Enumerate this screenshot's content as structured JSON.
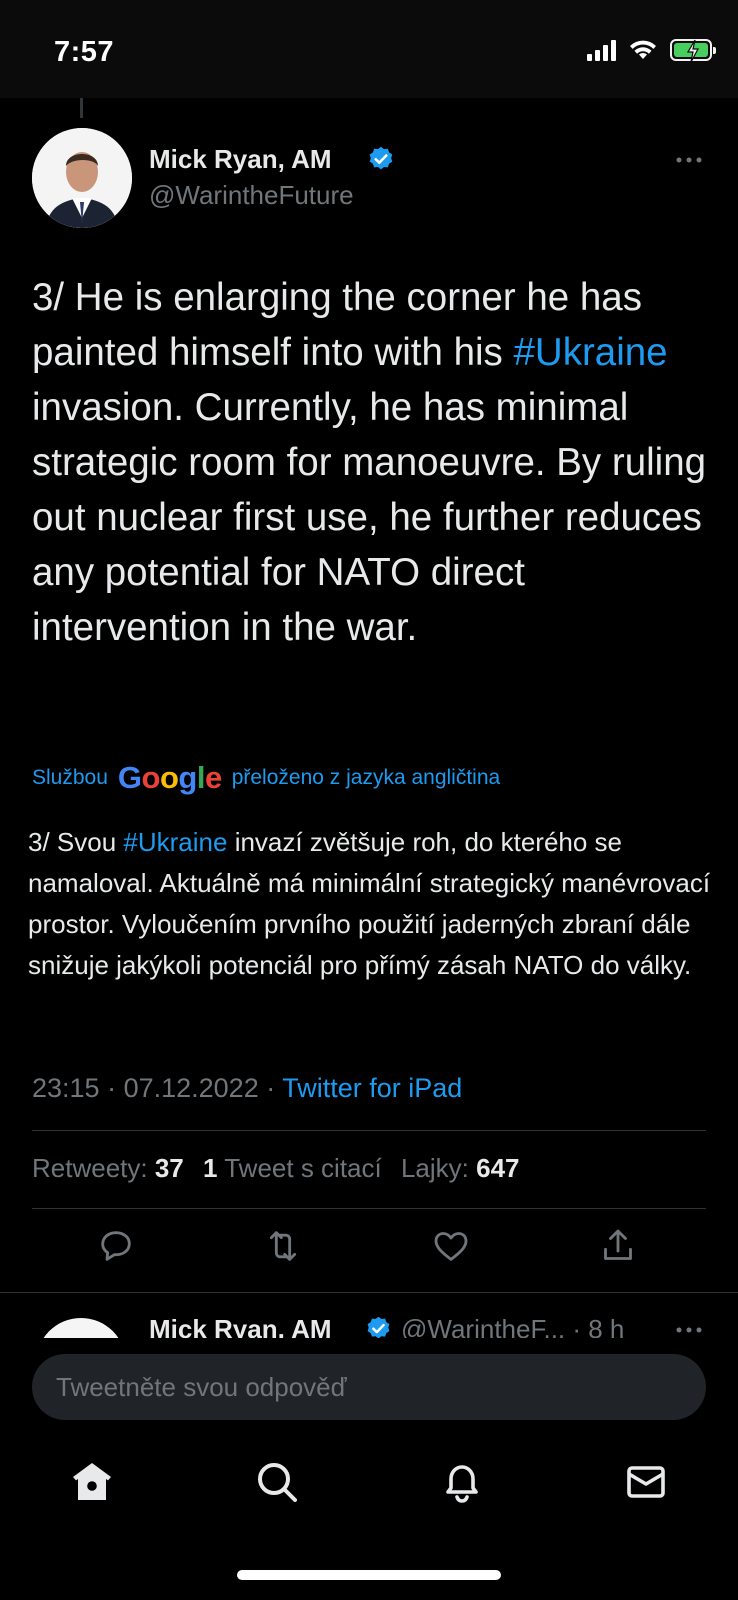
{
  "status_bar": {
    "time": "7:57",
    "icons": [
      "cellular-signal-icon",
      "wifi-icon",
      "battery-charging-icon"
    ]
  },
  "tweet": {
    "author": {
      "name": "Mick Ryan, AM",
      "handle": "@WarintheFuture",
      "verified": true
    },
    "text": {
      "before": "3/ He is enlarging the corner he has painted himself into with his ",
      "hashtag": "#Ukraine",
      "after": " invasion. Currently, he has minimal strategic room for manoeuvre. By ruling out nuclear first use, he further reduces any potential for NATO direct intervention in the war."
    },
    "translation_notice": {
      "prefix": "Službou",
      "provider": "Google",
      "suffix": "přeloženo z jazyka angličtina"
    },
    "translation": {
      "before": "3/ Svou ",
      "hashtag": "#Ukraine",
      "after": " invazí zvětšuje roh, do kterého se namaloval. Aktuálně má minimální strategický manévrovací prostor. Vyloučením prvního použití jaderných zbraní dále snižuje jakýkoli potenciál pro přímý zásah NATO do války."
    },
    "meta": {
      "time": "23:15",
      "separator": " · ",
      "date": "07.12.2022",
      "source": "Twitter for iPad"
    },
    "stats": {
      "retweets_label": "Retweety:",
      "retweets_count": "37",
      "quotes_count": "1",
      "quotes_label": "Tweet s citací",
      "likes_label": "Lajky:",
      "likes_count": "647"
    },
    "actions": [
      "reply-icon",
      "retweet-icon",
      "like-icon",
      "share-icon"
    ]
  },
  "next_tweet": {
    "author_name": "Mick Ryan, AM",
    "handle_and_time": "@WarintheF... · 8 h"
  },
  "reply": {
    "placeholder": "Tweetněte svou odpověď"
  },
  "tab_bar": {
    "items": [
      "home-icon",
      "search-icon",
      "notifications-icon",
      "messages-icon"
    ]
  },
  "colors": {
    "background": "#000000",
    "text": "#e7e9ea",
    "secondary": "#71767b",
    "accent": "#1d9bf0",
    "divider": "#2f3336"
  }
}
